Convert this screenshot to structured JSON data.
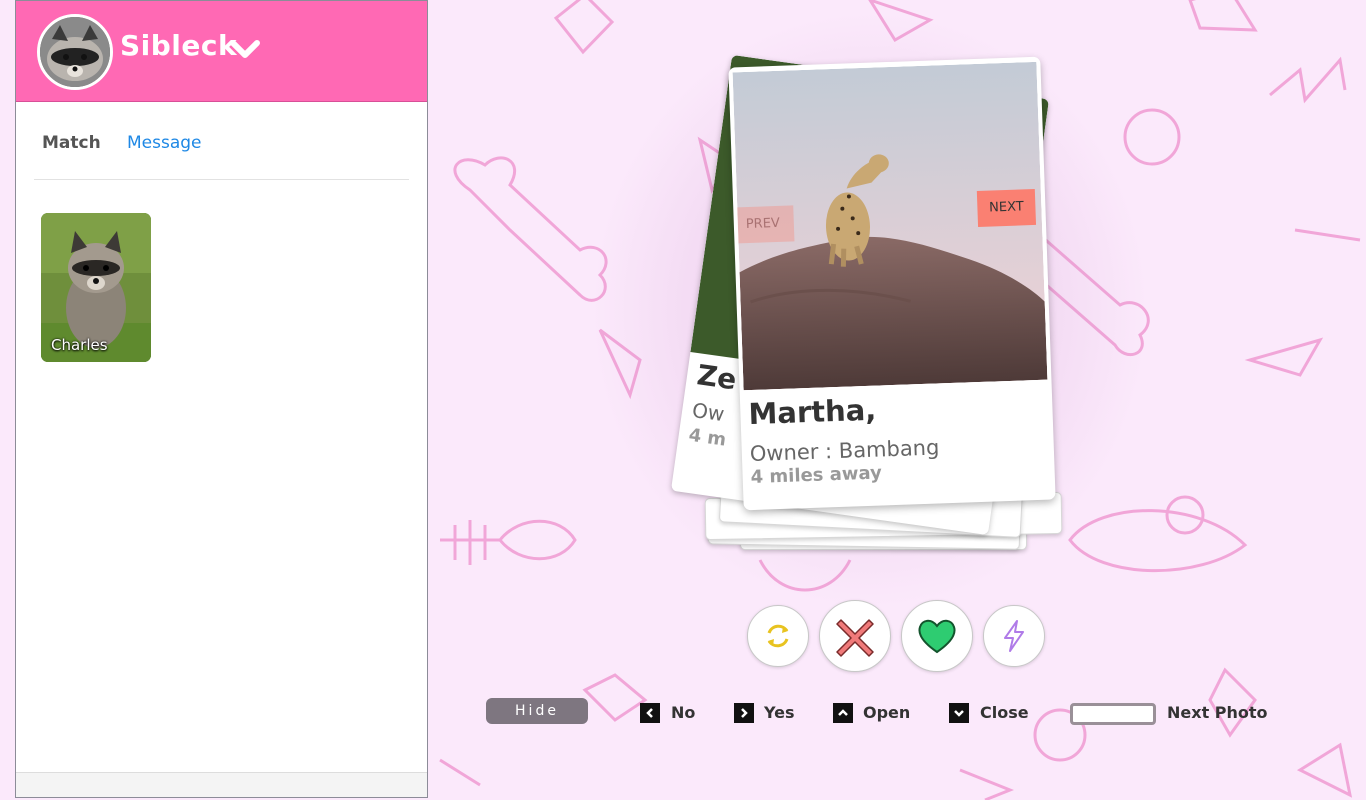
{
  "sidebar": {
    "username": "Sibleck",
    "tabs": [
      {
        "label": "Match"
      },
      {
        "label": "Message"
      }
    ],
    "matches": [
      {
        "name": "Charles"
      }
    ]
  },
  "cards": {
    "current": {
      "name": "Martha,",
      "owner": "Owner : Bambang",
      "distance": "4 miles away",
      "prev_label": "PREV",
      "next_label": "NEXT"
    },
    "behind": {
      "name": "Ze",
      "owner": "Ow",
      "distance": "4 m"
    }
  },
  "actions": {
    "rewind": "rewind-icon",
    "nope": "x-icon",
    "like": "heart-icon",
    "boost": "lightning-icon"
  },
  "legend": {
    "hide_label": "Hide",
    "items": [
      {
        "key": "left-arrow",
        "label": "No"
      },
      {
        "key": "right-arrow",
        "label": "Yes"
      },
      {
        "key": "up-arrow",
        "label": "Open"
      },
      {
        "key": "down-arrow",
        "label": "Close"
      },
      {
        "key": "space",
        "label": "Next Photo"
      }
    ]
  },
  "colors": {
    "brand": "#ff69b4",
    "link": "#1e88e5",
    "next_button": "#fa8072",
    "like": "#2ecc71"
  }
}
